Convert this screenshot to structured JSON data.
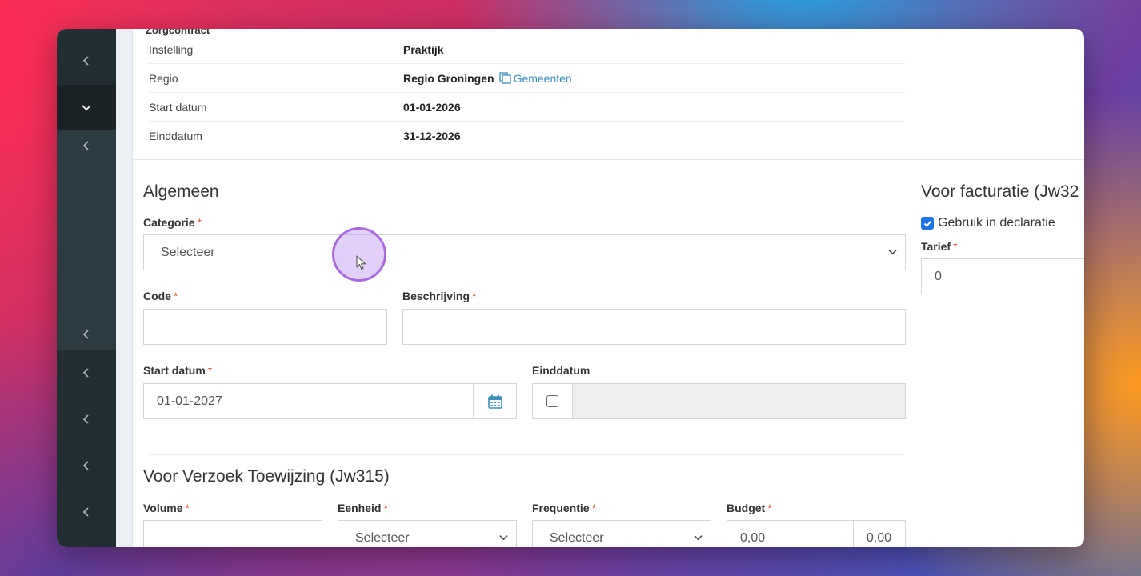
{
  "contract": {
    "section_title": "Zorgcontract",
    "rows": [
      {
        "label": "Instelling",
        "value": "Praktijk"
      },
      {
        "label": "Regio",
        "value": "Regio Groningen",
        "link": "Gemeenten"
      },
      {
        "label": "Start datum",
        "value": "01-01-2026"
      },
      {
        "label": "Einddatum",
        "value": "31-12-2026"
      }
    ]
  },
  "algemeen": {
    "title": "Algemeen",
    "categorie_label": "Categorie",
    "categorie_value": "Selecteer",
    "code_label": "Code",
    "code_value": "",
    "beschrijving_label": "Beschrijving",
    "beschrijving_value": "",
    "start_label": "Start datum",
    "start_value": "01-01-2027",
    "eind_label": "Einddatum",
    "required_mark": "*"
  },
  "facturatie": {
    "title": "Voor facturatie (Jw32",
    "gebruik_label": "Gebruik in declaratie",
    "tarief_label": "Tarief",
    "tarief_value": "0"
  },
  "toewijzing": {
    "title": "Voor Verzoek Toewijzing (Jw315)",
    "volume_label": "Volume",
    "volume_value": "",
    "eenheid_label": "Eenheid",
    "eenheid_value": "Selecteer",
    "frequentie_label": "Frequentie",
    "frequentie_value": "Selecteer",
    "budget_label": "Budget",
    "budget_value": "0,00",
    "budget_value2": "0,00"
  },
  "colors": {
    "sidebar": "#222d32",
    "link": "#3c8dbc",
    "required": "#dd4b39",
    "checkbox": "#1e73e8"
  },
  "icons": {
    "sidebar": [
      "chevron-left-icon",
      "chevron-down-icon",
      "chevron-left-icon",
      "chevron-left-icon",
      "chevron-left-icon",
      "chevron-left-icon",
      "chevron-left-icon",
      "chevron-left-icon"
    ],
    "date": "calendar-icon",
    "link": "copy-icon"
  }
}
